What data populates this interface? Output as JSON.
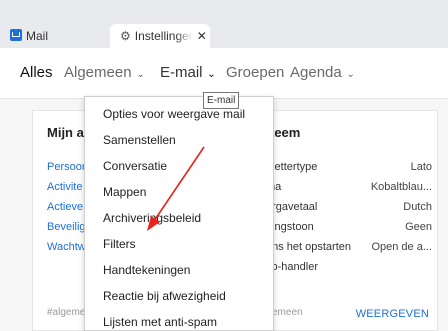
{
  "tabs": [
    {
      "label": "Mail",
      "icon": "mail-icon"
    },
    {
      "label": "Instellingen",
      "icon": "gear-icon",
      "close_icon": "close-icon"
    }
  ],
  "nav": {
    "items": [
      "Alles",
      "Algemeen",
      "E-mail",
      "Groepen",
      "Agenda"
    ],
    "active": "Alles"
  },
  "tooltip": "E-mail",
  "left_card": {
    "title": "Mijn ac",
    "links": [
      "Persoon",
      "Activite",
      "Actieve",
      "Beveilig",
      "Wachtw"
    ],
    "footer": "#algeme"
  },
  "right_card": {
    "title": "teem",
    "settings": [
      {
        "key": "t lettertype",
        "value": "Lato"
      },
      {
        "key": "ma",
        "value": "Kobaltblau..."
      },
      {
        "key": "ergavetaal",
        "value": "Dutch"
      },
      {
        "key": "dingstoon",
        "value": "Geen"
      },
      {
        "key": "ens het opstarten",
        "value": "Open de a..."
      },
      {
        "key": "To-handler",
        "value": ""
      }
    ],
    "footer": "emeen",
    "button": "WEERGEVEN"
  },
  "menu": [
    "Opties voor weergave mail",
    "Samenstellen",
    "Conversatie",
    "Mappen",
    "Archiveringsbeleid",
    "Filters",
    "Handtekeningen",
    "Reactie bij afwezigheid",
    "Lijsten met anti-spam"
  ],
  "colors": {
    "accent": "#1e6fd9",
    "annotation": "#e8231d",
    "tabbar": "#e9eaed"
  }
}
